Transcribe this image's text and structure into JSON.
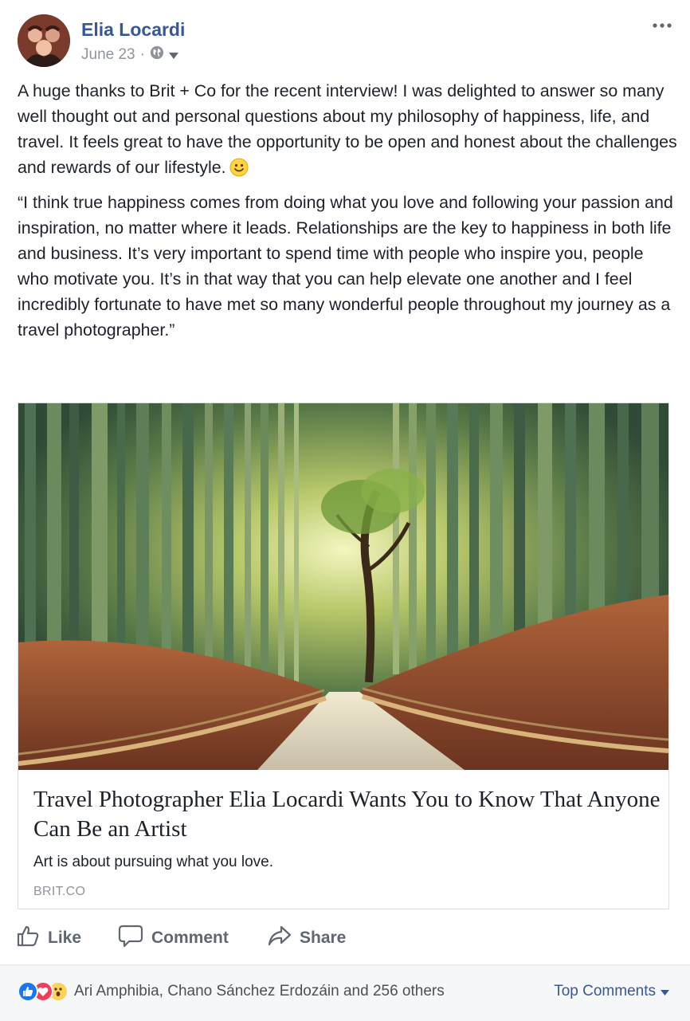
{
  "post": {
    "author": "Elia Locardi",
    "date": "June 23",
    "date_separator": "·",
    "privacy_icon": "globe-icon",
    "paragraphs": [
      "A huge thanks to Brit + Co for the recent interview! I was delighted to answer so many well thought out and personal questions about my philosophy of happiness, life, and travel. It feels great to have the opportunity to be open and honest about the challenges and rewards of our lifestyle.",
      "“I think true happiness comes from doing what you love and following your passion and inspiration, no matter where it leads. Relationships are the key to happiness in both life and business. It’s very important to spend time with people who inspire you, people who motivate you. It’s in that way that you can help elevate one another and I feel incredibly fortunate to have met so many wonderful people throughout my journey as a travel photographer.”"
    ]
  },
  "link_card": {
    "title": "Travel Photographer Elia Locardi Wants You to Know That Anyone Can Be an Artist",
    "description": "Art is about pursuing what you love.",
    "domain": "BRIT.CO"
  },
  "actions": {
    "like": "Like",
    "comment": "Comment",
    "share": "Share"
  },
  "footer": {
    "reactions_text": "Ari Amphibia, Chano Sánchez Erdozáin and 256 others",
    "top_comments": "Top Comments"
  },
  "colors": {
    "link_blue": "#365899",
    "like_blue": "#1877f2",
    "love_red": "#f33e58",
    "wow_yellow": "#fcd25a"
  }
}
